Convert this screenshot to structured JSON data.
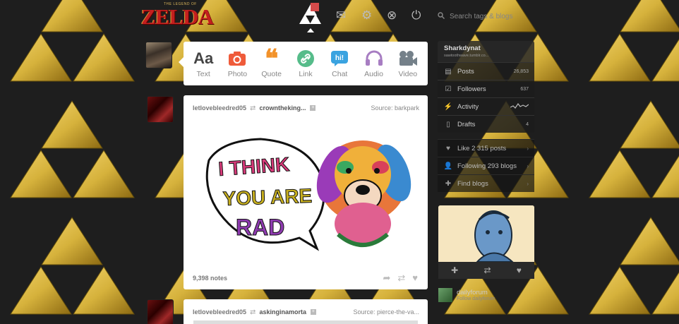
{
  "header": {
    "logo_text": "ZELDA",
    "logo_small": "THE LEGEND OF",
    "search_placeholder": "Search tags & blogs"
  },
  "composer": {
    "types": [
      {
        "label": "Text",
        "icon": "text-icon"
      },
      {
        "label": "Photo",
        "icon": "camera-icon"
      },
      {
        "label": "Quote",
        "icon": "quote-icon"
      },
      {
        "label": "Link",
        "icon": "link-icon"
      },
      {
        "label": "Chat",
        "icon": "chat-icon"
      },
      {
        "label": "Audio",
        "icon": "headphones-icon"
      },
      {
        "label": "Video",
        "icon": "video-camera-icon"
      }
    ]
  },
  "posts": [
    {
      "blog": "letlovebleedred05",
      "source_blog": "crowntheking...",
      "source": "Source: barkpark",
      "image_text": [
        "I THINK",
        "YOU ARE",
        "RAD"
      ],
      "notes": "9,398 notes"
    },
    {
      "blog": "letlovebleedred05",
      "source_blog": "askinginamorta",
      "source": "Source: pierce-the-va..."
    }
  ],
  "sidebar": {
    "blog_name": "Sharkdynat",
    "blog_url": "sawtoothwave.tumblr.co...",
    "rows": [
      {
        "label": "Posts",
        "count": "26,853",
        "icon": "posts-icon"
      },
      {
        "label": "Followers",
        "count": "637",
        "icon": "followers-icon"
      },
      {
        "label": "Activity",
        "count": "",
        "icon": "activity-icon"
      },
      {
        "label": "Drafts",
        "count": "4",
        "icon": "drafts-icon"
      }
    ],
    "rows2": [
      {
        "label": "Like 2 315 posts",
        "icon": "heart-icon"
      },
      {
        "label": "Following 293 blogs",
        "icon": "person-icon"
      },
      {
        "label": "Find blogs",
        "icon": "plus-icon"
      }
    ],
    "recommended": {
      "name": "dailyforum",
      "desc": "Follow dailyforum"
    }
  },
  "colors": {
    "gold": "#d6b23c",
    "zelda_red": "#c31f1f"
  }
}
